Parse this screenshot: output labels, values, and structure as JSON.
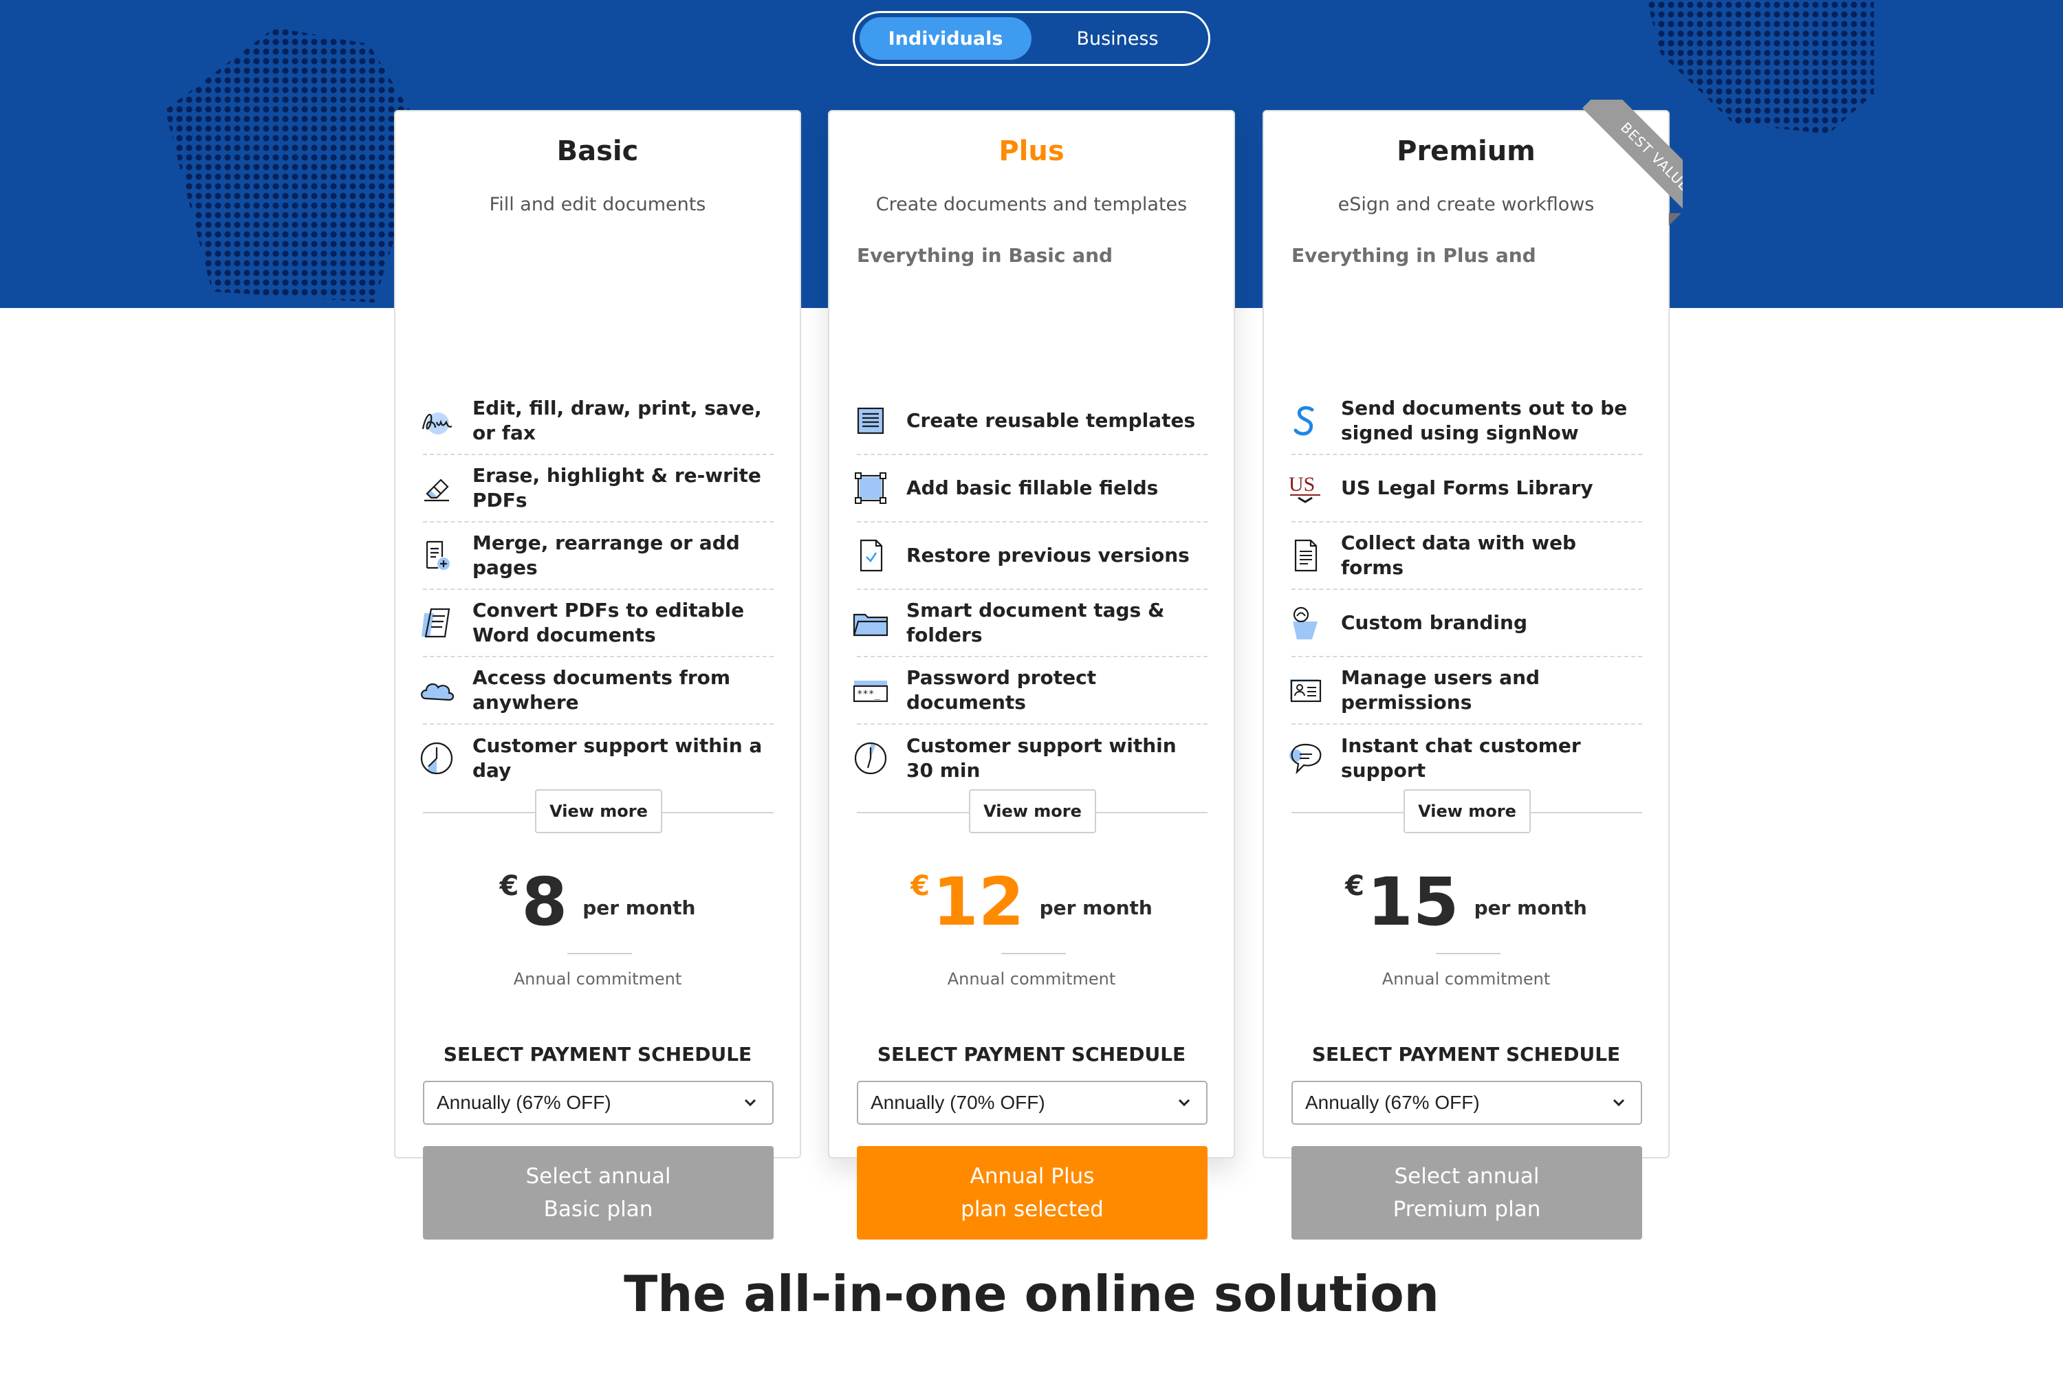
{
  "toggle": {
    "individuals": "Individuals",
    "business": "Business"
  },
  "plans": [
    {
      "name": "Basic",
      "subtitle": "Fill and edit documents",
      "everything": "",
      "features": [
        {
          "icon": "signature-icon",
          "text": "Edit, fill, draw, print, save, or fax"
        },
        {
          "icon": "eraser-icon",
          "text": "Erase, highlight & re-write PDFs"
        },
        {
          "icon": "add-page-icon",
          "text": "Merge, rearrange or add pages"
        },
        {
          "icon": "convert-doc-icon",
          "text": "Convert PDFs to editable Word documents"
        },
        {
          "icon": "cloud-icon",
          "text": "Access documents from anywhere"
        },
        {
          "icon": "clock-icon",
          "text": "Customer support within a day"
        }
      ],
      "view_more": "View more",
      "currency": "€",
      "price": "8",
      "per": "per month",
      "commitment": "Annual commitment",
      "schedule_label": "SELECT PAYMENT SCHEDULE",
      "schedule_value": "Annually (67% OFF)",
      "cta_line1": "Select annual",
      "cta_line2": "Basic plan"
    },
    {
      "name": "Plus",
      "subtitle": "Create documents and templates",
      "everything": "Everything in Basic and",
      "features": [
        {
          "icon": "template-icon",
          "text": "Create reusable templates"
        },
        {
          "icon": "fillable-fields-icon",
          "text": "Add basic fillable fields"
        },
        {
          "icon": "restore-version-icon",
          "text": "Restore previous versions"
        },
        {
          "icon": "folder-icon",
          "text": "Smart document tags & folders"
        },
        {
          "icon": "password-icon",
          "text": "Password protect documents"
        },
        {
          "icon": "clock-icon",
          "text": "Customer support within 30 min"
        }
      ],
      "view_more": "View more",
      "currency": "€",
      "price": "12",
      "per": "per month",
      "commitment": "Annual commitment",
      "schedule_label": "SELECT PAYMENT SCHEDULE",
      "schedule_value": "Annually (70% OFF)",
      "cta_line1": "Annual Plus",
      "cta_line2": "plan selected"
    },
    {
      "name": "Premium",
      "subtitle": "eSign and create workflows",
      "everything": "Everything in Plus and",
      "features": [
        {
          "icon": "signnow-icon",
          "text": "Send documents out to be signed using signNow"
        },
        {
          "icon": "us-legal-forms-icon",
          "text": "US Legal Forms Library"
        },
        {
          "icon": "web-form-icon",
          "text": "Collect data with web forms"
        },
        {
          "icon": "branding-icon",
          "text": "Custom branding"
        },
        {
          "icon": "users-permissions-icon",
          "text": "Manage users and permissions"
        },
        {
          "icon": "chat-icon",
          "text": "Instant chat customer support"
        }
      ],
      "view_more": "View more",
      "currency": "€",
      "price": "15",
      "per": "per month",
      "commitment": "Annual commitment",
      "schedule_label": "SELECT PAYMENT SCHEDULE",
      "schedule_value": "Annually (67% OFF)",
      "cta_line1": "Select annual",
      "cta_line2": "Premium plan"
    }
  ],
  "ribbon": "BEST VALUE",
  "bottom_title": "The all-in-one online solution",
  "colors": {
    "hero_blue": "#0f4c9f",
    "toggle_active": "#3e9bf0",
    "accent_orange": "#ff8a00",
    "cta_gray": "#a3a3a3"
  }
}
